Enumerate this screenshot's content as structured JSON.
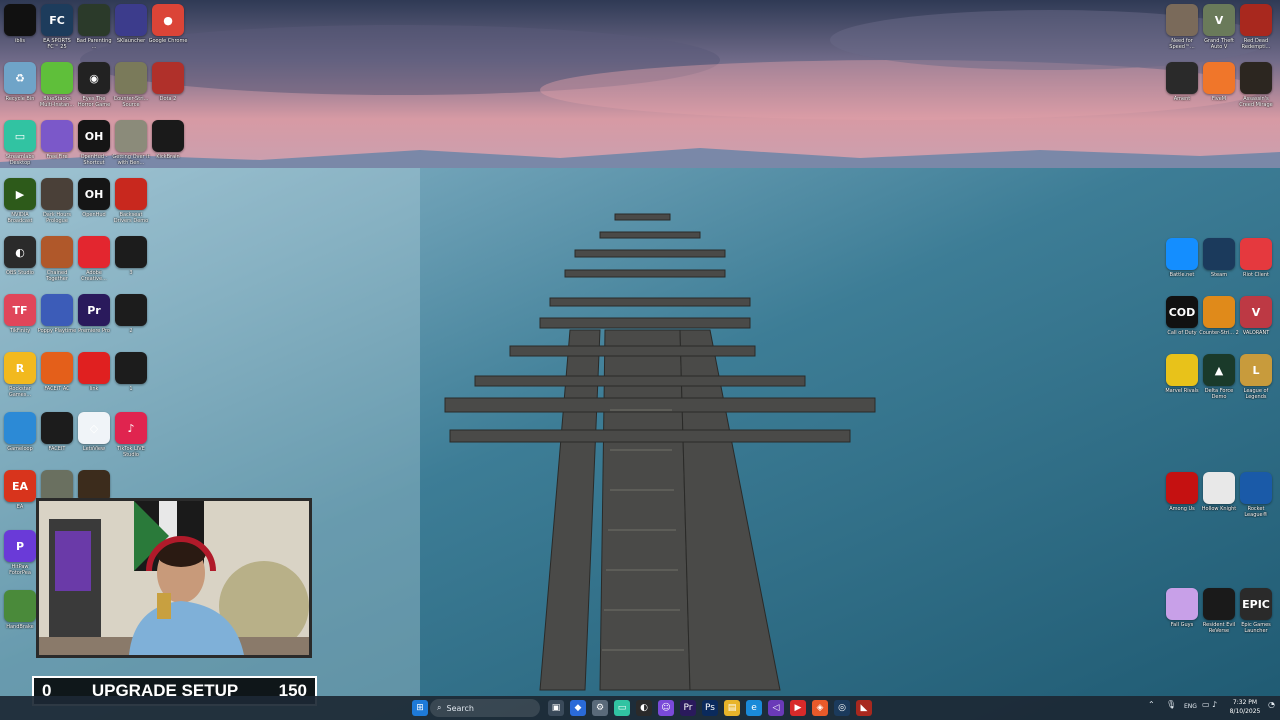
{
  "desktop_icons_left": [
    {
      "label": "iblis",
      "glyph": "",
      "color": "#111111"
    },
    {
      "label": "EA SPORTS FC™ 25",
      "glyph": "FC",
      "color": "#1d3c5c"
    },
    {
      "label": "Bad Parenting ...",
      "glyph": "",
      "color": "#2b3a2a"
    },
    {
      "label": "SKlauncher",
      "glyph": "",
      "color": "#3c3c8c"
    },
    {
      "label": "Google Chrome",
      "glyph": "●",
      "color": "#db4437"
    },
    {
      "label": "Recycle Bin",
      "glyph": "♻",
      "color": "#6fa4c8"
    },
    {
      "label": "BlueStacks Multi-Instan...",
      "glyph": "",
      "color": "#5fbf3a"
    },
    {
      "label": "Eyes The Horror Game",
      "glyph": "◉",
      "color": "#222222"
    },
    {
      "label": "Counter-Stri... Source",
      "glyph": "",
      "color": "#7a7a5a"
    },
    {
      "label": "Dota 2",
      "glyph": "",
      "color": "#b0302a"
    },
    {
      "label": "Streamlabs Desktop",
      "glyph": "▭",
      "color": "#31c3a2"
    },
    {
      "label": "Free Fire",
      "glyph": "",
      "color": "#7b58c9"
    },
    {
      "label": "OpenHud - Shortcut",
      "glyph": "OH",
      "color": "#151515"
    },
    {
      "label": "Getting Over It with Ben...",
      "glyph": "",
      "color": "#8b8b7a"
    },
    {
      "label": "KickBrain",
      "glyph": "",
      "color": "#1a1a1a"
    },
    {
      "label": "NVIDIA Broadcast",
      "glyph": "▶",
      "color": "#2d5a1a"
    },
    {
      "label": "Dark Hours Prologue",
      "glyph": "",
      "color": "#4a4038"
    },
    {
      "label": "OpenHud",
      "glyph": "OH",
      "color": "#151515"
    },
    {
      "label": "Backseat Drivers Demo",
      "glyph": "",
      "color": "#c8281e"
    },
    {
      "label": "OBS Studio",
      "glyph": "◐",
      "color": "#2a2a2a"
    },
    {
      "label": "Chained Together",
      "glyph": "",
      "color": "#b0582a"
    },
    {
      "label": "Adobe Creative...",
      "glyph": "",
      "color": "#e3262f"
    },
    {
      "label": "3",
      "glyph": "",
      "color": "#1c1c1c"
    },
    {
      "label": "TikFinity",
      "glyph": "TF",
      "color": "#e0465a"
    },
    {
      "label": "Poppy Playtime",
      "glyph": "",
      "color": "#3c5cb8"
    },
    {
      "label": "Premiere Pro",
      "glyph": "Pr",
      "color": "#2a1a5c"
    },
    {
      "label": "2",
      "glyph": "",
      "color": "#1c1c1c"
    },
    {
      "label": "Rockstar Games...",
      "glyph": "R",
      "color": "#f2b91e"
    },
    {
      "label": "FACEIT AC",
      "glyph": "",
      "color": "#e45f1a"
    },
    {
      "label": "link",
      "glyph": "",
      "color": "#e02020"
    },
    {
      "label": "1",
      "glyph": "",
      "color": "#1c1c1c"
    },
    {
      "label": "Gameloop",
      "glyph": "",
      "color": "#2c8ad6"
    },
    {
      "label": "FACEIT",
      "glyph": "",
      "color": "#1c1c1c"
    },
    {
      "label": "LetsView",
      "glyph": "◇",
      "color": "#f0f4f8"
    },
    {
      "label": "TikTok LIVE Studio",
      "glyph": "♪",
      "color": "#e0244f"
    },
    {
      "label": "EA",
      "glyph": "EA",
      "color": "#d8341c"
    },
    {
      "label": "",
      "glyph": "",
      "color": "#6a7060"
    },
    {
      "label": "",
      "glyph": "",
      "color": "#3c2c1c"
    },
    {
      "label": "HitPaw FotorPea",
      "glyph": "P",
      "color": "#6a3ad8"
    },
    {
      "label": "HandBrake",
      "glyph": "",
      "color": "#4a8a3a"
    }
  ],
  "desktop_icons_right": [
    {
      "label": "Need for Speed™...",
      "glyph": "",
      "color": "#7a6a5a"
    },
    {
      "label": "Grand Theft Auto V",
      "glyph": "V",
      "color": "#6a7a5a"
    },
    {
      "label": "Red Dead Redempti...",
      "glyph": "",
      "color": "#a8281e"
    },
    {
      "label": "Ament",
      "glyph": "",
      "color": "#2a2a2a"
    },
    {
      "label": "FiveM",
      "glyph": "",
      "color": "#f0762a"
    },
    {
      "label": "Assassin's Creed Mirage",
      "glyph": "",
      "color": "#2c2620"
    },
    {
      "label": "Battle.net",
      "glyph": "",
      "color": "#148eff"
    },
    {
      "label": "Steam",
      "glyph": "",
      "color": "#1b3a5c"
    },
    {
      "label": "Riot Client",
      "glyph": "",
      "color": "#e5393e"
    },
    {
      "label": "Call of Duty",
      "glyph": "COD",
      "color": "#111111"
    },
    {
      "label": "Counter-Stri... 2",
      "glyph": "",
      "color": "#e08a1a"
    },
    {
      "label": "VALORANT",
      "glyph": "V",
      "color": "#bd3944"
    },
    {
      "label": "Marvel Rivals",
      "glyph": "",
      "color": "#e8c21a"
    },
    {
      "label": "Delta Force Demo",
      "glyph": "▲",
      "color": "#1a3a2a"
    },
    {
      "label": "League of Legends",
      "glyph": "L",
      "color": "#c89b3c"
    },
    {
      "label": "Among Us",
      "glyph": "",
      "color": "#c51111"
    },
    {
      "label": "Hollow Knight",
      "glyph": "",
      "color": "#e8e8e8"
    },
    {
      "label": "Rocket League®",
      "glyph": "",
      "color": "#1a5aa8"
    },
    {
      "label": "Fall Guys",
      "glyph": "",
      "color": "#c8a0e8"
    },
    {
      "label": "Resident Evil ReVerse",
      "glyph": "",
      "color": "#1a1a1a"
    },
    {
      "label": "Epic Games Launcher",
      "glyph": "EPIC",
      "color": "#2a2a2a"
    }
  ],
  "overlay": {
    "left_value": "0",
    "title": "UPGRADE SETUP",
    "right_value": "150"
  },
  "taskbar": {
    "search_placeholder": "Search",
    "time": "7:32 PM",
    "date": "8/10/2025",
    "tray_lang": "ENG"
  }
}
